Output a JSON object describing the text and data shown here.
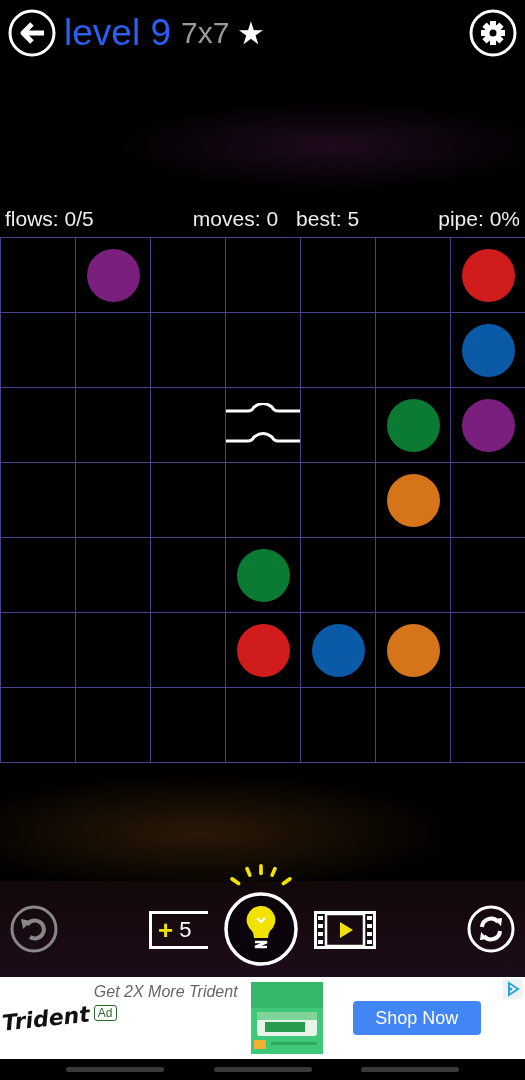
{
  "header": {
    "level": "level 9",
    "size": "7x7",
    "star": "★"
  },
  "stats": {
    "flows": "flows: 0/5",
    "moves": "moves: 0",
    "best": "best: 5",
    "pipe": "pipe: 0%"
  },
  "grid": {
    "rows": [
      [
        {
          "kind": "empty"
        },
        {
          "kind": "dot",
          "color": "#7b1f7f"
        },
        {
          "kind": "empty"
        },
        {
          "kind": "empty"
        },
        {
          "kind": "empty"
        },
        {
          "kind": "empty"
        },
        {
          "kind": "dot",
          "color": "#d01c1c"
        }
      ],
      [
        {
          "kind": "empty"
        },
        {
          "kind": "empty"
        },
        {
          "kind": "empty"
        },
        {
          "kind": "empty"
        },
        {
          "kind": "empty"
        },
        {
          "kind": "empty"
        },
        {
          "kind": "dot",
          "color": "#0a5aa8"
        }
      ],
      [
        {
          "kind": "empty"
        },
        {
          "kind": "empty"
        },
        {
          "kind": "empty"
        },
        {
          "kind": "bridge"
        },
        {
          "kind": "empty"
        },
        {
          "kind": "dot",
          "color": "#0b7a32"
        },
        {
          "kind": "dot",
          "color": "#7b1f7f"
        }
      ],
      [
        {
          "kind": "empty"
        },
        {
          "kind": "empty"
        },
        {
          "kind": "empty"
        },
        {
          "kind": "empty"
        },
        {
          "kind": "empty"
        },
        {
          "kind": "dot",
          "color": "#d6741a"
        },
        {
          "kind": "empty"
        }
      ],
      [
        {
          "kind": "empty"
        },
        {
          "kind": "empty"
        },
        {
          "kind": "empty"
        },
        {
          "kind": "dot",
          "color": "#0b7a32"
        },
        {
          "kind": "empty"
        },
        {
          "kind": "empty"
        },
        {
          "kind": "empty"
        }
      ],
      [
        {
          "kind": "empty"
        },
        {
          "kind": "empty"
        },
        {
          "kind": "empty"
        },
        {
          "kind": "dot",
          "color": "#d01c1c"
        },
        {
          "kind": "dot",
          "color": "#0a5aa8"
        },
        {
          "kind": "dot",
          "color": "#d6741a"
        },
        {
          "kind": "empty"
        }
      ],
      [
        {
          "kind": "empty"
        },
        {
          "kind": "empty"
        },
        {
          "kind": "empty"
        },
        {
          "kind": "empty"
        },
        {
          "kind": "empty"
        },
        {
          "kind": "empty"
        },
        {
          "kind": "empty"
        }
      ]
    ]
  },
  "controls": {
    "hints_plus": "+",
    "hints_count": "5"
  },
  "ad": {
    "logo": "Trident",
    "headline": "Get 2X More Trident",
    "badge": "Ad",
    "button": "Shop Now"
  }
}
